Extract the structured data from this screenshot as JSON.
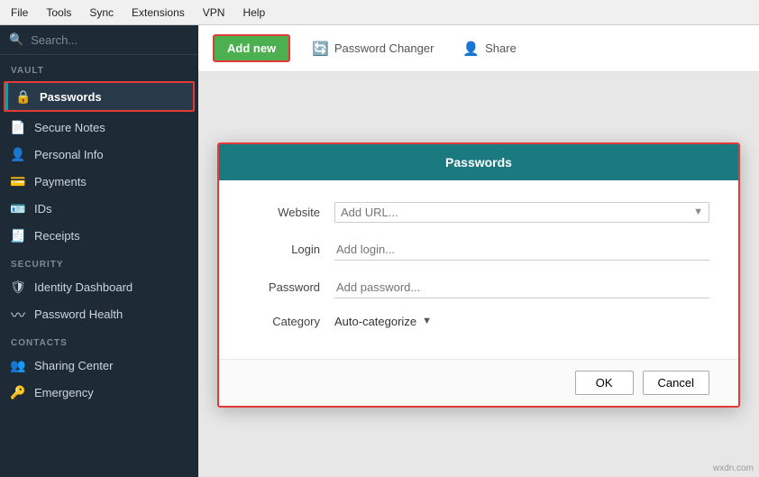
{
  "menubar": {
    "items": [
      "File",
      "Tools",
      "Sync",
      "Extensions",
      "VPN",
      "Help"
    ]
  },
  "sidebar": {
    "search_placeholder": "Search...",
    "vault_label": "VAULT",
    "vault_items": [
      {
        "id": "passwords",
        "label": "Passwords",
        "icon": "🔒",
        "active": true
      },
      {
        "id": "secure-notes",
        "label": "Secure Notes",
        "icon": "📄"
      },
      {
        "id": "personal-info",
        "label": "Personal Info",
        "icon": "👤"
      },
      {
        "id": "payments",
        "label": "Payments",
        "icon": "💳"
      },
      {
        "id": "ids",
        "label": "IDs",
        "icon": "🪪"
      },
      {
        "id": "receipts",
        "label": "Receipts",
        "icon": "🧾"
      }
    ],
    "security_label": "SECURITY",
    "security_items": [
      {
        "id": "identity-dashboard",
        "label": "Identity Dashboard",
        "icon": "🛡"
      },
      {
        "id": "password-health",
        "label": "Password Health",
        "icon": "〰"
      }
    ],
    "contacts_label": "CONTACTS",
    "contacts_items": [
      {
        "id": "sharing-center",
        "label": "Sharing Center",
        "icon": "👥"
      },
      {
        "id": "emergency",
        "label": "Emergency",
        "icon": "🔑"
      }
    ]
  },
  "toolbar": {
    "add_new_label": "Add new",
    "password_changer_label": "Password Changer",
    "share_label": "Share"
  },
  "dialog": {
    "title": "Passwords",
    "fields": {
      "website_label": "Website",
      "website_placeholder": "Add URL...",
      "login_label": "Login",
      "login_placeholder": "Add login...",
      "password_label": "Password",
      "password_placeholder": "Add password...",
      "category_label": "Category",
      "category_value": "Auto-categorize"
    },
    "ok_label": "OK",
    "cancel_label": "Cancel"
  },
  "watermark": "wxdn.com"
}
